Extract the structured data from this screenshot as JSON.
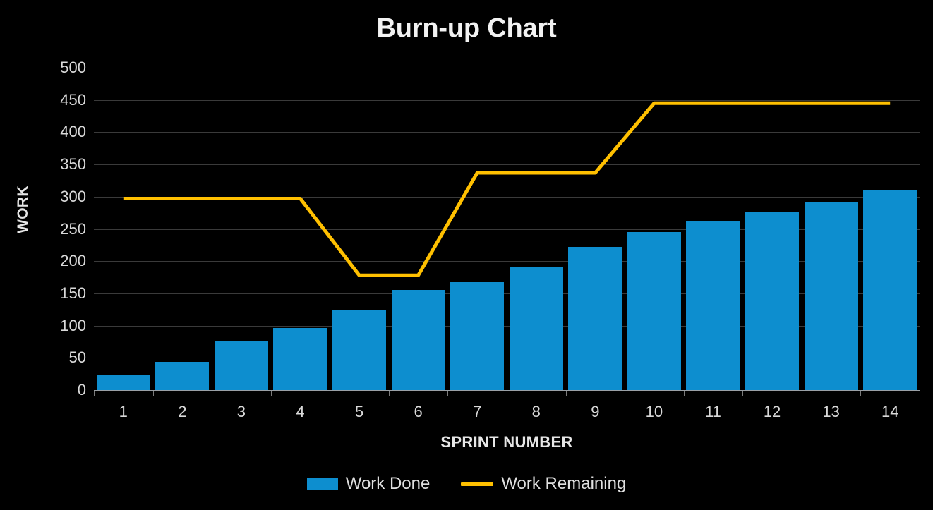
{
  "chart_data": {
    "type": "bar",
    "title": "Burn-up Chart",
    "xlabel": "SPRINT NUMBER",
    "ylabel": "WORK",
    "categories": [
      "1",
      "2",
      "3",
      "4",
      "5",
      "6",
      "7",
      "8",
      "9",
      "10",
      "11",
      "12",
      "13",
      "14"
    ],
    "series": [
      {
        "name": "Work Done",
        "type": "bar",
        "color": "#0d8ecf",
        "values": [
          24,
          44,
          75,
          96,
          125,
          155,
          167,
          190,
          222,
          245,
          261,
          277,
          292,
          310
        ]
      },
      {
        "name": "Work Remaining",
        "type": "line",
        "color": "#ffc000",
        "values": [
          297,
          297,
          297,
          297,
          178,
          178,
          337,
          337,
          337,
          445,
          445,
          445,
          445,
          445
        ]
      }
    ],
    "ylim": [
      0,
      500
    ],
    "yticks": [
      0,
      50,
      100,
      150,
      200,
      250,
      300,
      350,
      400,
      450,
      500
    ],
    "ytick_labels": [
      "0",
      "50",
      "100",
      "150",
      "200",
      "250",
      "300",
      "350",
      "400",
      "450",
      "500"
    ],
    "grid": true,
    "legend_position": "bottom",
    "background_color": "#000000",
    "text_color": "#e6e6e6",
    "gridline_color": "#3a3a3a"
  },
  "legend": {
    "entries": [
      {
        "label": "Work Done"
      },
      {
        "label": "Work Remaining"
      }
    ]
  }
}
